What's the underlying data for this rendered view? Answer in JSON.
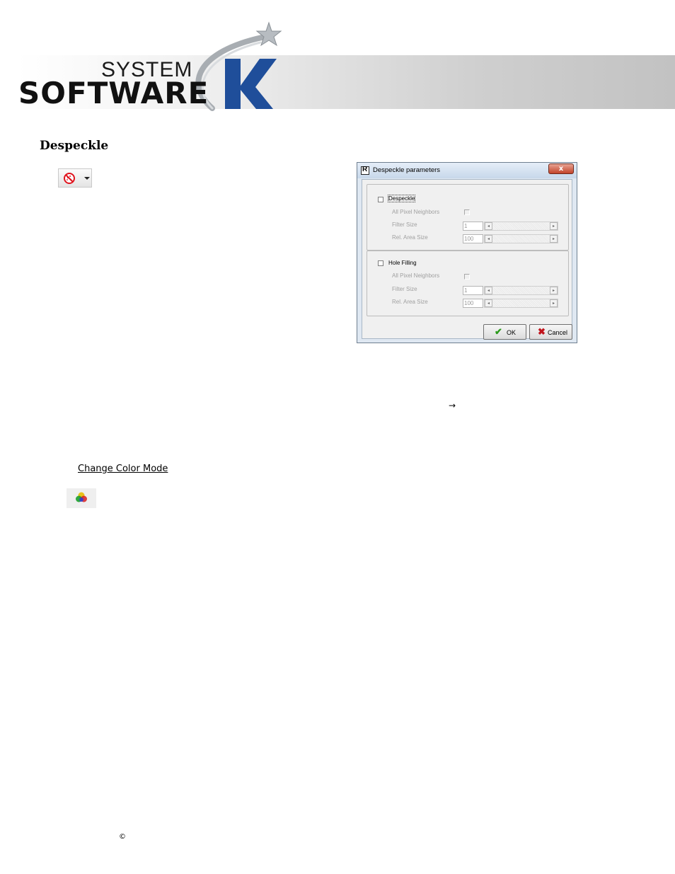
{
  "logo": {
    "line1": "SYSTEM",
    "line2": "SOFTWARE",
    "letter": "K",
    "colors": {
      "k_blue": "#1f4e9a",
      "swoosh_silver": "#9ea4aa",
      "text_dark": "#111111"
    }
  },
  "section": {
    "title": "Despeckle"
  },
  "toolbar_button": {
    "icon": "despeckle-no-icon",
    "dropdown": "chevron-down-icon"
  },
  "dialog": {
    "title": "Despeckle parameters",
    "close_label": "x",
    "despeckle": {
      "label": "Despeckle",
      "checked": false,
      "all_pixel_neighbors_label": "All Pixel Neighbors",
      "filter_size_label": "Filter Size",
      "filter_size_value": "1",
      "rel_area_size_label": "Rel. Area Size",
      "rel_area_size_value": "100"
    },
    "hole_filling": {
      "label": "Hole Filling",
      "checked": false,
      "all_pixel_neighbors_label": "All Pixel Neighbors",
      "filter_size_label": "Filter Size",
      "filter_size_value": "1",
      "rel_area_size_label": "Rel. Area Size",
      "rel_area_size_value": "100"
    },
    "ok_label": "OK",
    "cancel_label": "Cancel"
  },
  "body": {
    "arrow": "→",
    "change_color_mode_heading": "Change Color Mode",
    "color_mode_icon": "rgb-circles-icon",
    "copyright": "©"
  }
}
